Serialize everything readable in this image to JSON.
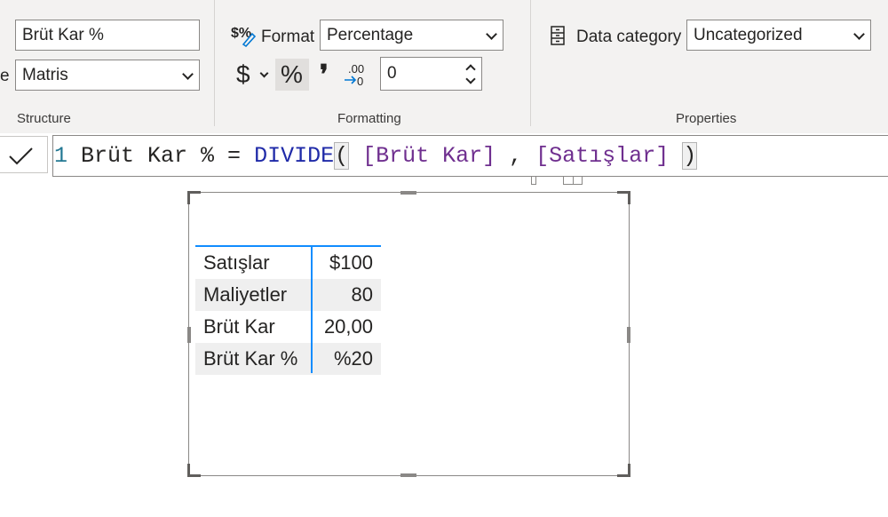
{
  "ribbon": {
    "structure": {
      "name_value": "Brüt Kar %",
      "home_table_label_partial": "e",
      "home_table_value": "Matris",
      "group_label": "Structure"
    },
    "formatting": {
      "format_label": "Format",
      "format_value": "Percentage",
      "currency_symbol": "$",
      "percent_symbol": "%",
      "comma_symbol": "❜",
      "decimal_icon_text": ".00",
      "decimal_icon_text2": "0",
      "decimals_value": "0",
      "group_label": "Formatting"
    },
    "properties": {
      "data_category_label": "Data category",
      "data_category_value": "Uncategorized",
      "group_label": "Properties"
    }
  },
  "formula": {
    "line_number": "1",
    "measure": "Brüt Kar % = ",
    "function": "DIVIDE",
    "open_paren": "(",
    "arg1": "[Brüt Kar]",
    "sep": " , ",
    "arg2": "[Satışlar]",
    "close_paren": ")"
  },
  "matrix": {
    "rows": [
      {
        "label": "Satışlar",
        "value": "$100"
      },
      {
        "label": "Maliyetler",
        "value": "80"
      },
      {
        "label": "Brüt Kar",
        "value": "20,00"
      },
      {
        "label": "Brüt Kar %",
        "value": "%20"
      }
    ]
  },
  "colors": {
    "accent": "#118dff",
    "ribbon_bg": "#f3f2f1",
    "dax_function": "#1f2aa8",
    "dax_reference": "#6f2f8f"
  }
}
